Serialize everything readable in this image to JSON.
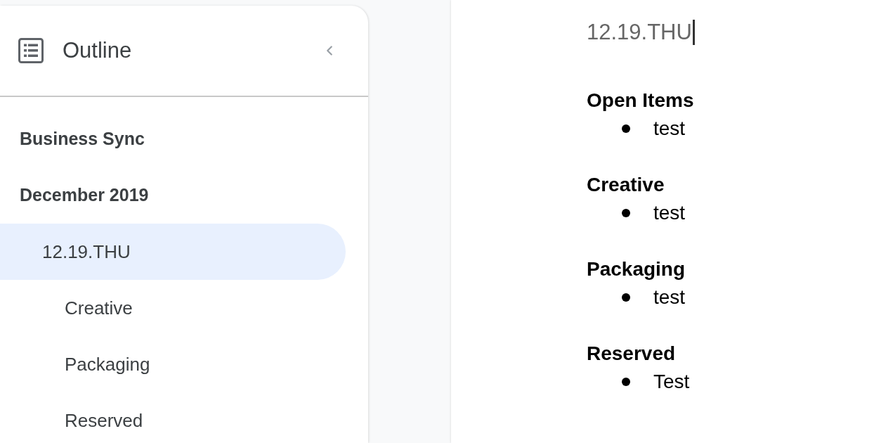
{
  "sidebar": {
    "title": "Outline",
    "items": [
      {
        "label": "Business Sync",
        "selected": false
      },
      {
        "label": "December 2019",
        "selected": false,
        "children": [
          {
            "label": "12.19.THU",
            "selected": true,
            "children": [
              {
                "label": "Creative",
                "selected": false
              },
              {
                "label": "Packaging",
                "selected": false
              },
              {
                "label": "Reserved",
                "selected": false
              }
            ]
          }
        ]
      }
    ]
  },
  "document": {
    "title": "12.19.THU",
    "caret": true,
    "sections": [
      {
        "heading": "Open Items",
        "items": [
          "test"
        ]
      },
      {
        "heading": "Creative",
        "items": [
          "test"
        ]
      },
      {
        "heading": "Packaging",
        "items": [
          "test"
        ]
      },
      {
        "heading": "Reserved",
        "items": [
          "Test"
        ]
      }
    ]
  }
}
